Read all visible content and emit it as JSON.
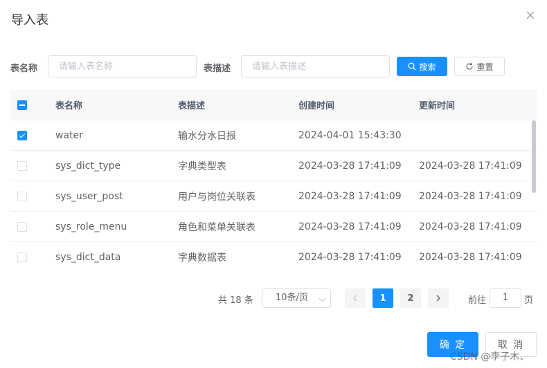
{
  "dialog": {
    "title": "导入表"
  },
  "form": {
    "name_label": "表名称",
    "name_placeholder": "请输入表名称",
    "desc_label": "表描述",
    "desc_placeholder": "请输入表描述",
    "search_label": "搜索",
    "reset_label": "重置"
  },
  "table": {
    "headers": {
      "name": "表名称",
      "desc": "表描述",
      "created": "创建时间",
      "updated": "更新时间"
    },
    "rows": [
      {
        "checked": true,
        "name": "water",
        "desc": "输水分水日报",
        "created": "2024-04-01 15:43:30",
        "updated": ""
      },
      {
        "checked": false,
        "name": "sys_dict_type",
        "desc": "字典类型表",
        "created": "2024-03-28 17:41:09",
        "updated": "2024-03-28 17:41:09"
      },
      {
        "checked": false,
        "name": "sys_user_post",
        "desc": "用户与岗位关联表",
        "created": "2024-03-28 17:41:09",
        "updated": "2024-03-28 17:41:09"
      },
      {
        "checked": false,
        "name": "sys_role_menu",
        "desc": "角色和菜单关联表",
        "created": "2024-03-28 17:41:09",
        "updated": "2024-03-28 17:41:09"
      },
      {
        "checked": false,
        "name": "sys_dict_data",
        "desc": "字典数据表",
        "created": "2024-03-28 17:41:09",
        "updated": "2024-03-28 17:41:09"
      }
    ]
  },
  "pagination": {
    "total": "共 18 条",
    "page_size": "10条/页",
    "pages": [
      "1",
      "2"
    ],
    "current_page": "1",
    "goto_prefix": "前往",
    "goto_value": "1",
    "goto_suffix": "页"
  },
  "footer": {
    "confirm": "确 定",
    "cancel": "取 消"
  },
  "watermark": "CSDN @李子木、",
  "colors": {
    "primary": "#1890ff",
    "border": "#dcdfe6",
    "header_bg": "#f8f8f9"
  },
  "icons": {
    "close": "close-icon",
    "search": "search-icon",
    "reset": "refresh-icon"
  }
}
